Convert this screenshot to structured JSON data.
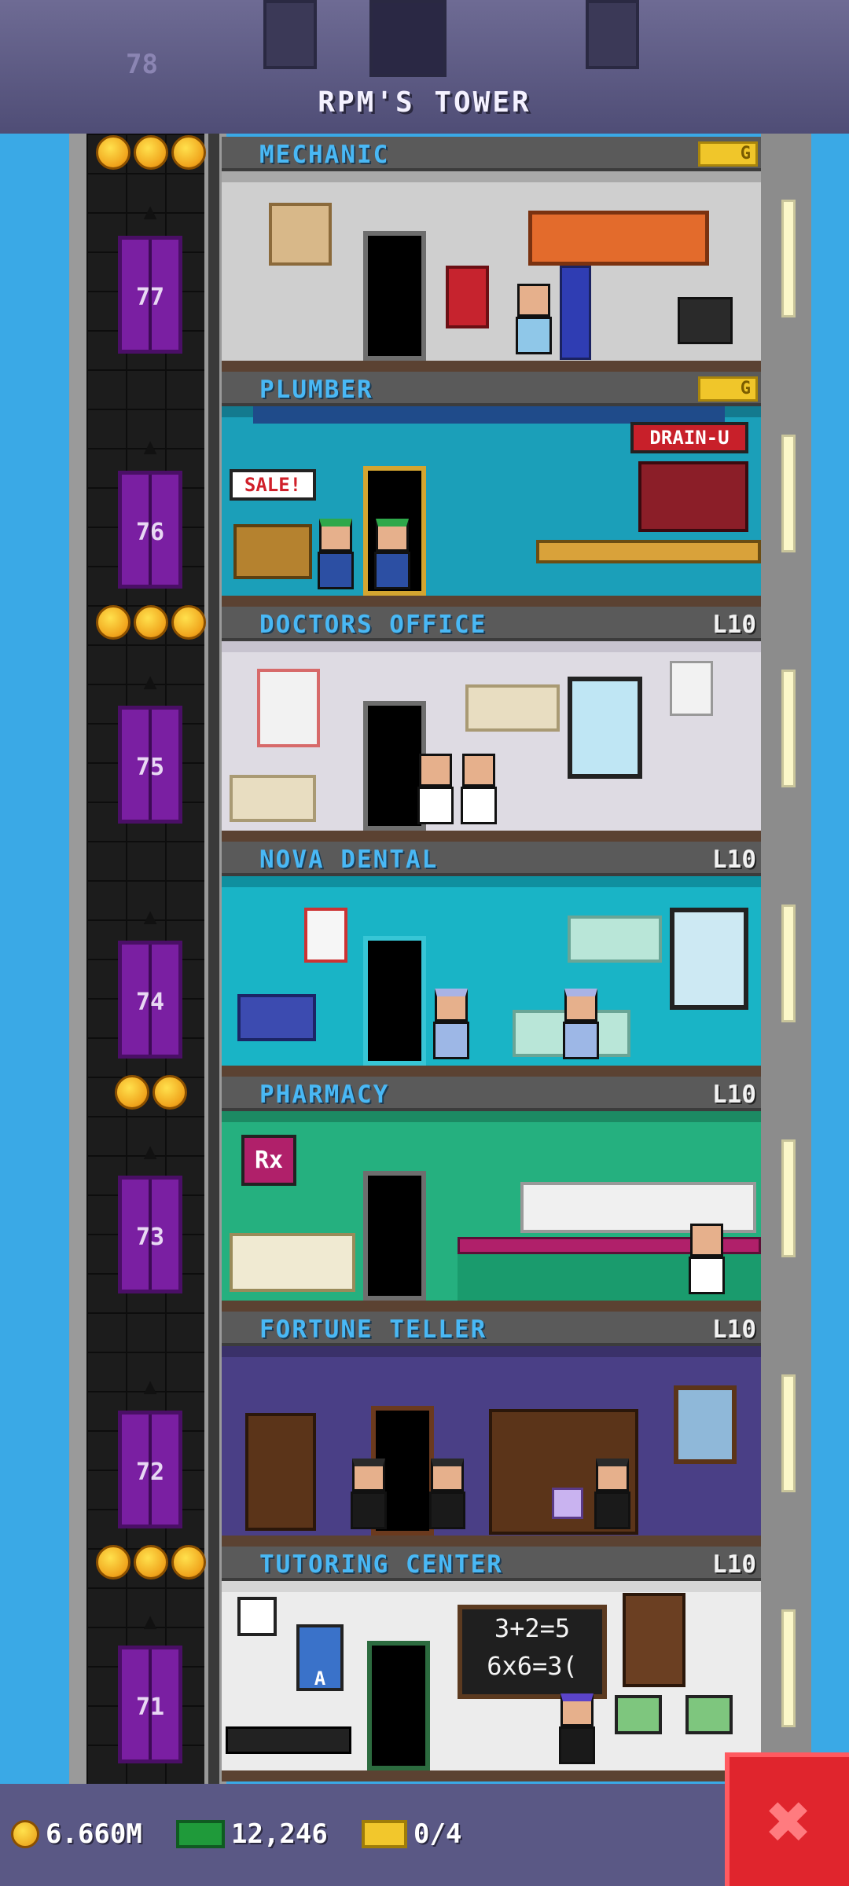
{
  "header": {
    "tower_title": "RPM'S TOWER",
    "partial_floor_number": "78"
  },
  "floors": [
    {
      "number": "77",
      "name": "MECHANIC",
      "badge": "G",
      "badge_type": "gold",
      "stars": 3,
      "bg": "#cfcfcf",
      "wall_accent": "#a9a9a9"
    },
    {
      "number": "76",
      "name": "PLUMBER",
      "badge": "G",
      "badge_type": "gold",
      "stars": 0,
      "bg": "#1b9fb9",
      "wall_accent": "#137a8f"
    },
    {
      "number": "75",
      "name": "DOCTORS OFFICE",
      "badge": "L10",
      "badge_type": "level",
      "stars": 3,
      "bg": "#dedbe3",
      "wall_accent": "#c7c3cf"
    },
    {
      "number": "74",
      "name": "NOVA DENTAL",
      "badge": "L10",
      "badge_type": "level",
      "stars": 0,
      "bg": "#19b4c6",
      "wall_accent": "#0f8f9f"
    },
    {
      "number": "73",
      "name": "PHARMACY",
      "badge": "L10",
      "badge_type": "level",
      "stars": 2,
      "bg": "#25b07f",
      "wall_accent": "#1c8a63"
    },
    {
      "number": "72",
      "name": "FORTUNE TELLER",
      "badge": "L10",
      "badge_type": "level",
      "stars": 0,
      "bg": "#4a3f86",
      "wall_accent": "#3a3169"
    },
    {
      "number": "71",
      "name": "TUTORING CENTER",
      "badge": "L10",
      "badge_type": "level",
      "stars": 3,
      "bg": "#ececec",
      "wall_accent": "#d6d6d6"
    }
  ],
  "room_signs": {
    "plumber_sign": "DRAIN-U",
    "plumber_sale": "SALE!",
    "pharmacy_sign": "Rx",
    "chalkboard_line1": "3+2=5",
    "chalkboard_line2": "6x6=3(",
    "apple_poster": "A"
  },
  "status_bar": {
    "coins": "6.660M",
    "bux": "12,246",
    "tickets": "0/4"
  },
  "colors": {
    "sky": "#3aa9e6",
    "elevator": "#7a1fa2",
    "floor_name": "#49b8f5",
    "close": "#e0252d"
  },
  "icons": {
    "close": "close-x-icon",
    "coin": "coin-icon",
    "bux": "bux-icon",
    "ticket": "vip-ticket-icon"
  }
}
